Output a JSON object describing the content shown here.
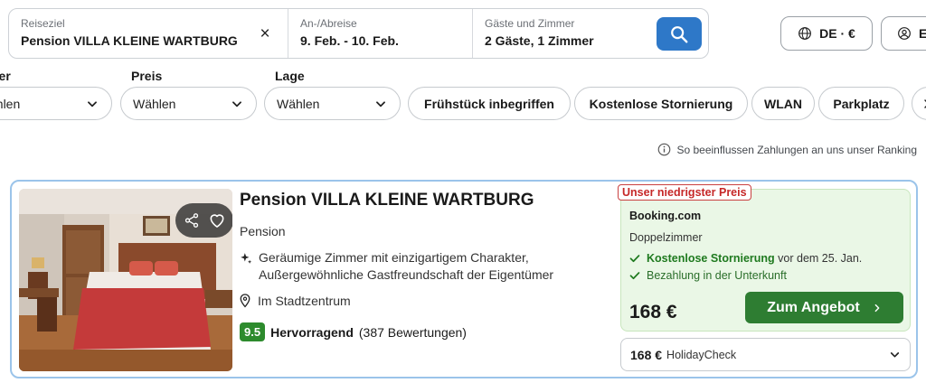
{
  "search": {
    "destination_label": "Reiseziel",
    "destination_value": "Pension VILLA KLEINE WARTBURG",
    "dates_label": "An-/Abreise",
    "dates_value": "9. Feb. - 10. Feb.",
    "guests_label": "Gäste und Zimmer",
    "guests_value": "2 Gäste, 1 Zimmer",
    "clear_glyph": "×"
  },
  "header": {
    "language_label": "DE · €",
    "login_label": "E"
  },
  "filters": [
    {
      "label": "lter",
      "value": "ählen"
    },
    {
      "label": "Preis",
      "value": "Wählen"
    },
    {
      "label": "Lage",
      "value": "Wählen"
    }
  ],
  "chips": [
    "Frühstück inbegriffen",
    "Kostenlose Stornierung",
    "WLAN",
    "Parkplatz"
  ],
  "ranking_note": "So beeinflussen Zahlungen an uns unser Ranking",
  "hotel": {
    "name": "Pension VILLA KLEINE WARTBURG",
    "type": "Pension",
    "feature_line1": "Geräumige Zimmer mit einzigartigem Charakter,",
    "feature_line2": "Außergewöhnliche Gastfreundschaft der Eigentümer",
    "location": "Im Stadtzentrum",
    "rating_score": "9.5",
    "rating_word": "Hervorragend",
    "rating_count": "(387 Bewertungen)"
  },
  "offer": {
    "badge": "Unser niedrigster Preis",
    "provider": "Booking.com",
    "room": "Doppelzimmer",
    "perk1_bold": "Kostenlose Stornierung",
    "perk1_rest": "vor dem 25. Jan.",
    "perk2": "Bezahlung in der Unterkunft",
    "price": "168 €",
    "button_label": "Zum Angebot"
  },
  "alt_offer": {
    "price": "168 €",
    "provider": "HolidayCheck"
  },
  "colors": {
    "accent_blue": "#2e78c8",
    "deal_green": "#2e7d32",
    "badge_red": "#c62828",
    "score_green": "#2d8b2d"
  }
}
